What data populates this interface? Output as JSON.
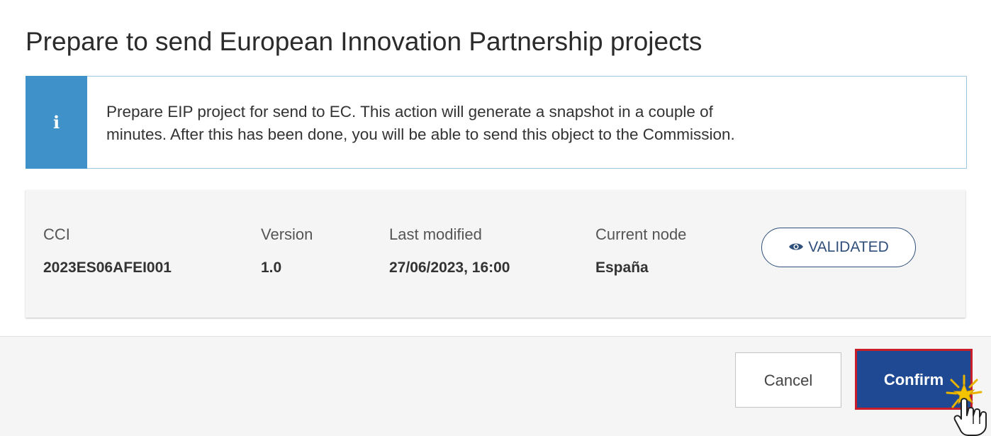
{
  "dialog": {
    "title": "Prepare to send European Innovation Partnership projects"
  },
  "info": {
    "icon": "info-icon",
    "icon_glyph": "i",
    "line1": "Prepare EIP project for send to EC. This action will generate a snapshot in a couple of",
    "line2": "minutes. After this has been done, you will be able to send this object to the Commission.",
    "accent_color": "#3f91c9"
  },
  "meta": {
    "cci_label": "CCI",
    "cci_value": "2023ES06AFEI001",
    "version_label": "Version",
    "version_value": "1.0",
    "modified_label": "Last modified",
    "modified_value": "27/06/2023, 16:00",
    "node_label": "Current node",
    "node_value": "España",
    "status": "VALIDATED",
    "status_icon": "eye-icon",
    "status_color": "#2f4f7a"
  },
  "footer": {
    "cancel_label": "Cancel",
    "confirm_label": "Confirm",
    "confirm_color": "#1f4a93",
    "highlight_color": "#c81e2a"
  }
}
